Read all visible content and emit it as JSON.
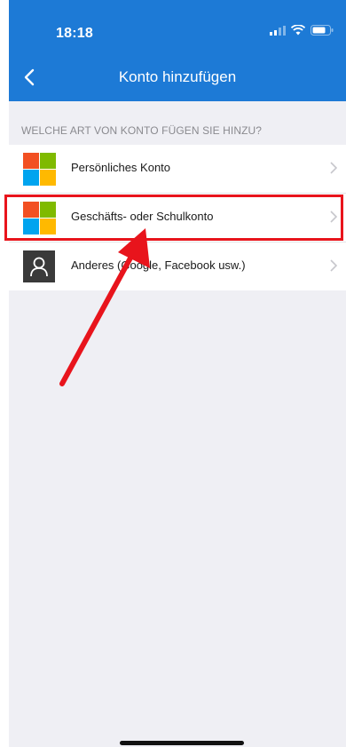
{
  "status_bar": {
    "time": "18:18"
  },
  "nav": {
    "title": "Konto hinzufügen"
  },
  "section": {
    "header": "WELCHE ART VON KONTO FÜGEN SIE HINZU?"
  },
  "accounts": [
    {
      "label": "Persönliches Konto",
      "icon": "microsoft-logo-icon"
    },
    {
      "label": "Geschäfts- oder Schulkonto",
      "icon": "microsoft-logo-icon",
      "highlighted": true
    },
    {
      "label": "Anderes (Google, Facebook usw.)",
      "icon": "person-icon"
    }
  ],
  "colors": {
    "header_blue": "#1d7ad6",
    "highlight_red": "#e8141c",
    "ms_red": "#f25022",
    "ms_green": "#7fba00",
    "ms_blue": "#00a4ef",
    "ms_yellow": "#ffb900"
  }
}
